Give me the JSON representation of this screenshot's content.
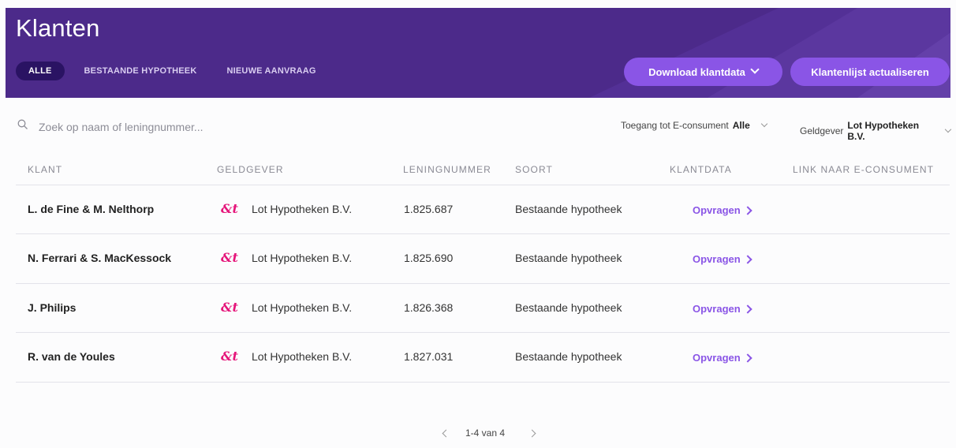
{
  "header": {
    "title": "Klanten",
    "tabs": [
      {
        "label": "ALLE",
        "active": true
      },
      {
        "label": "BESTAANDE HYPOTHEEK",
        "active": false
      },
      {
        "label": "NIEUWE AANVRAAG",
        "active": false
      }
    ],
    "download_label": "Download klantdata",
    "refresh_label": "Klantenlijst actualiseren"
  },
  "filters": {
    "search_placeholder": "Zoek op naam of leningnummer...",
    "access_label": "Toegang tot E-consument",
    "access_value": "Alle",
    "lender_label": "Geldgever",
    "lender_value": "Lot Hypotheken B.V."
  },
  "table": {
    "columns": [
      "KLANT",
      "GELDGEVER",
      "LENINGNUMMER",
      "SOORT",
      "KLANTDATA",
      "LINK NAAR E-CONSUMENT"
    ],
    "rows": [
      {
        "klant": "L. de Fine & M. Nelthorp",
        "geldgever": "Lot Hypotheken B.V.",
        "leningnummer": "1.825.687",
        "soort": "Bestaande hypotheek",
        "klantdata": "Opvragen"
      },
      {
        "klant": "N. Ferrari & S. MacKessock",
        "geldgever": "Lot Hypotheken B.V.",
        "leningnummer": "1.825.690",
        "soort": "Bestaande hypotheek",
        "klantdata": "Opvragen"
      },
      {
        "klant": "J. Philips",
        "geldgever": "Lot Hypotheken B.V.",
        "leningnummer": "1.826.368",
        "soort": "Bestaande hypotheek",
        "klantdata": "Opvragen"
      },
      {
        "klant": "R. van de Youles",
        "geldgever": "Lot Hypotheken B.V.",
        "leningnummer": "1.827.031",
        "soort": "Bestaande hypotheek",
        "klantdata": "Opvragen"
      }
    ]
  },
  "pagination": {
    "label": "1-4 van 4"
  },
  "icons": {
    "search": "search-icon",
    "dropdown": "chevron-down-icon",
    "lender_logo": "lot-logo-icon",
    "prev": "chevron-left-icon",
    "next": "chevron-right-icon"
  },
  "colors": {
    "header_bg": "#4c2a8a",
    "active_tab": "#2a1363",
    "accent": "#8a55e6",
    "logo": "#e5157a"
  }
}
